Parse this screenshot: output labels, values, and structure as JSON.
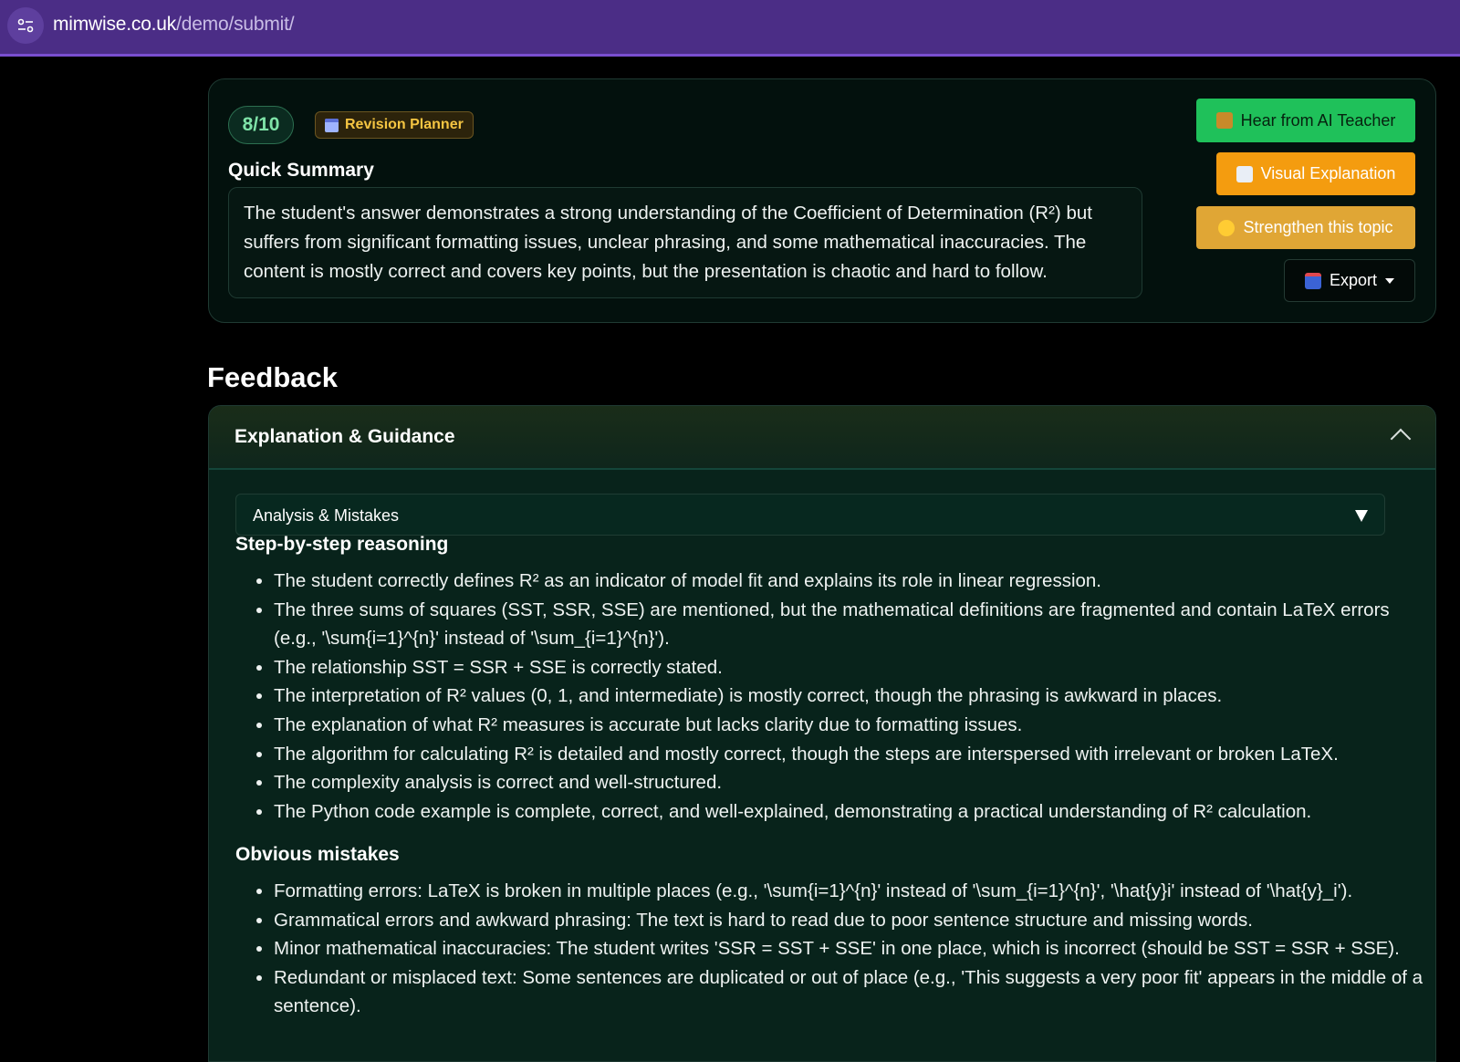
{
  "browser": {
    "url_host": "mimwise.co.uk",
    "url_path": "/demo/submit/"
  },
  "summary": {
    "score": "8/10",
    "planner_label": "Revision Planner",
    "title": "Quick Summary",
    "text": "The student's answer demonstrates a strong understanding of the Coefficient of Determination (R²) but suffers from significant formatting issues, unclear phrasing, and some mathematical inaccuracies. The content is mostly correct and covers key points, but the presentation is chaotic and hard to follow."
  },
  "actions": {
    "teacher": "Hear from AI Teacher",
    "visual": "Visual Explanation",
    "strengthen": "Strengthen this topic",
    "export": "Export"
  },
  "feedback": {
    "heading": "Feedback",
    "panel_title": "Explanation & Guidance",
    "dropdown_value": "Analysis & Mistakes",
    "reasoning_title": "Step-by-step reasoning",
    "reasoning": [
      "The student correctly defines R² as an indicator of model fit and explains its role in linear regression.",
      "The three sums of squares (SST, SSR, SSE) are mentioned, but the mathematical definitions are fragmented and contain LaTeX errors (e.g., '\\sum{i=1}^{n}' instead of '\\sum_{i=1}^{n}').",
      "The relationship SST = SSR + SSE is correctly stated.",
      "The interpretation of R² values (0, 1, and intermediate) is mostly correct, though the phrasing is awkward in places.",
      "The explanation of what R² measures is accurate but lacks clarity due to formatting issues.",
      "The algorithm for calculating R² is detailed and mostly correct, though the steps are interspersed with irrelevant or broken LaTeX.",
      "The complexity analysis is correct and well-structured.",
      "The Python code example is complete, correct, and well-explained, demonstrating a practical understanding of R² calculation."
    ],
    "mistakes_title": "Obvious mistakes",
    "mistakes": [
      "Formatting errors: LaTeX is broken in multiple places (e.g., '\\sum{i=1}^{n}' instead of '\\sum_{i=1}^{n}', '\\hat{y}i' instead of '\\hat{y}_i').",
      "Grammatical errors and awkward phrasing: The text is hard to read due to poor sentence structure and missing words.",
      "Minor mathematical inaccuracies: The student writes 'SSR = SST + SSE' in one place, which is incorrect (should be SST = SSR + SSE).",
      "Redundant or misplaced text: Some sentences are duplicated or out of place (e.g., 'This suggests a very poor fit' appears in the middle of a sentence)."
    ]
  }
}
